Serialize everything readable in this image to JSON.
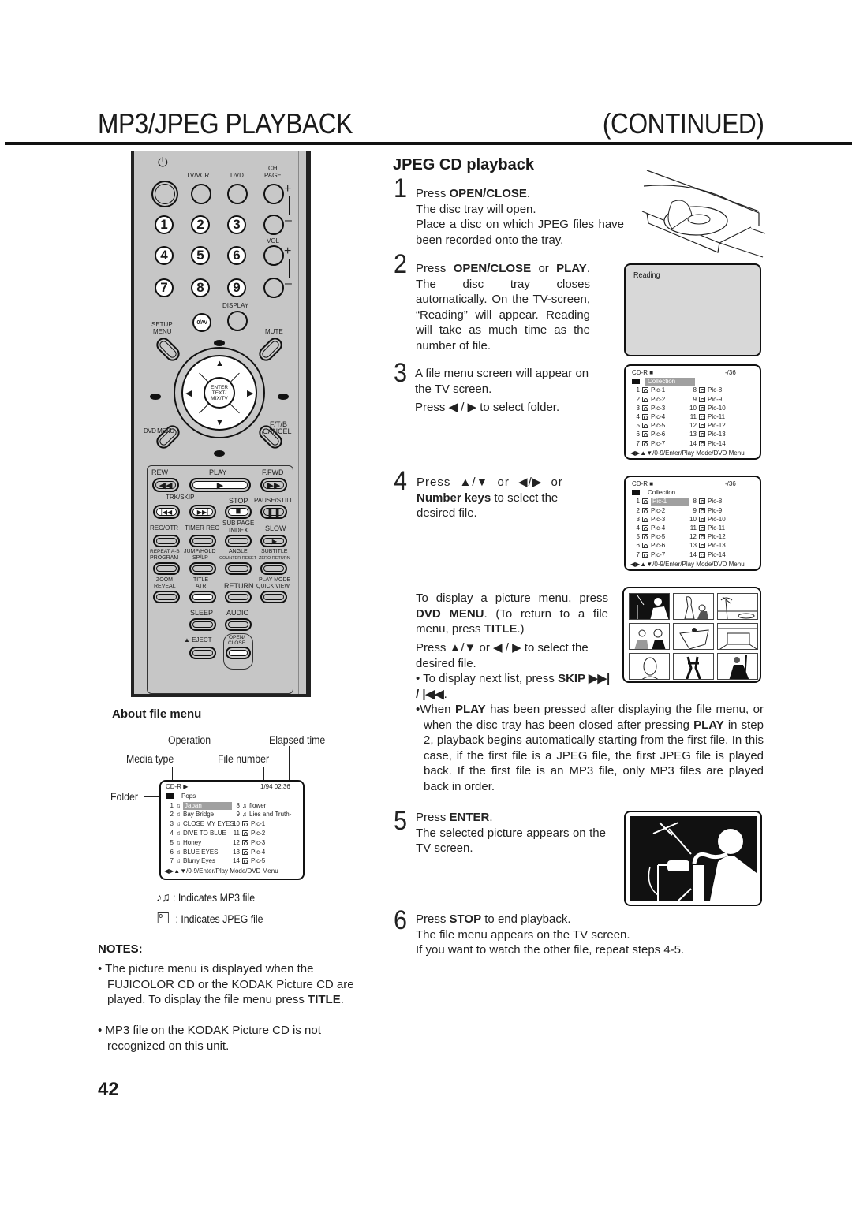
{
  "header": {
    "title": "MP3/JPEG PLAYBACK",
    "continued": "(CONTINUED)"
  },
  "remote": {
    "power_icon": "⏻",
    "top_labels": [
      "TV/VCR",
      "DVD",
      "CH",
      "PAGE"
    ],
    "numbers": [
      "1",
      "2",
      "3",
      "4",
      "5",
      "6",
      "7",
      "8",
      "9"
    ],
    "vol_label": "VOL",
    "display_label": "DISPLAY",
    "zero_av": "0/AV",
    "setup": "SETUP",
    "menu": "MENU",
    "mute": "MUTE",
    "enter_lines": [
      "ENTER",
      "TEXT/",
      "MIX/TV"
    ],
    "dvd_menu": "DVD MENU",
    "ftb": "F/T/B",
    "cancel": "CANCEL",
    "rew": "REW",
    "play": "PLAY",
    "ffwd": "F.FWD",
    "trk_skip": "TRK/SKIP",
    "stop": "STOP",
    "pause_still": "PAUSE/STILL",
    "rec_otr": "REC/OTR",
    "timer_rec": "TIMER REC",
    "sub_page": "SUB PAGE",
    "index": "INDEX",
    "slow": "SLOW",
    "repeat_ab": "REPEAT A-B",
    "program": "PROGRAM",
    "jump_hold": "JUMP/HOLD",
    "sp_lp": "SP/LP",
    "angle": "ANGLE",
    "counter_reset": "COUNTER RESET",
    "subtitle": "SUBTITLE",
    "zero_return": "ZERO RETURN",
    "zoom": "ZOOM",
    "reveal": "REVEAL",
    "title": "TITLE",
    "atr": "ATR",
    "return": "RETURN",
    "play_mode": "PLAY MODE",
    "quick_view": "QUICK VIEW",
    "sleep": "SLEEP",
    "audio": "AUDIO",
    "eject": "▲ EJECT",
    "open_close_1": "OPEN/",
    "open_close_2": "CLOSE"
  },
  "section_title": "JPEG CD playback",
  "steps": {
    "s1": {
      "num": "1",
      "l1_pre": "Press ",
      "l1_b": "OPEN/CLOSE",
      "l1_post": ".",
      "l2": "The disc tray will open.",
      "l3": "Place a disc on which JPEG files have been recorded onto the tray."
    },
    "s2": {
      "num": "2",
      "pre": "Press ",
      "b1": "OPEN/CLOSE",
      "mid": " or ",
      "b2": "PLAY",
      "post": ".",
      "body": "The disc tray closes automatically. On the TV-screen, “Reading” will appear. Reading will take as much time as the number of file."
    },
    "s3": {
      "num": "3",
      "l1": "A file menu screen will appear on the TV screen.",
      "l2": "Press ◀ / ▶ to select folder."
    },
    "s4": {
      "num": "4",
      "l1": "Press ▲/▼ or ◀/▶ or",
      "b": "Number keys",
      "l2": " to select the desired file."
    },
    "picture_menu": {
      "p1_pre": "To display a picture menu, press ",
      "p1_b1": "DVD MENU",
      "p1_mid": ". (To return to a file menu, press ",
      "p1_b2": "TITLE",
      "p1_post": ".)",
      "p2": "Press ▲/▼ or ◀ / ▶ to select the desired file.",
      "bullet1_pre": "To display next list, press ",
      "bullet1_b": "SKIP ▶▶| / |◀◀",
      "bullet1_post": ".",
      "bullet2_pre": "When ",
      "bullet2_b1": "PLAY",
      "bullet2_mid": " has been pressed after displaying the file menu, or when the disc tray has been closed after pressing ",
      "bullet2_b2": "PLAY",
      "bullet2_post": " in step 2, playback begins automatically starting from the first file. In this case, if the first file is a JPEG file, the first JPEG file is played back. If the first file is an MP3 file, only MP3 files are played back in order."
    },
    "s5": {
      "num": "5",
      "pre": "Press ",
      "b": "ENTER",
      "post": ".",
      "body": "The selected picture appears on the TV screen."
    },
    "s6": {
      "num": "6",
      "pre": "Press ",
      "b": "STOP",
      "post": " to end playback.",
      "l2": "The file menu appears on the TV screen.",
      "l3": "If you want to watch the other file, repeat steps 4-5."
    }
  },
  "tv_reading": {
    "text": "Reading"
  },
  "file_menu_jpeg": {
    "media": "CD-R",
    "status_icon": "■",
    "count": "-/36",
    "folder": "Collection",
    "left": [
      {
        "n": "1",
        "name": "Pic-1"
      },
      {
        "n": "2",
        "name": "Pic-2"
      },
      {
        "n": "3",
        "name": "Pic-3"
      },
      {
        "n": "4",
        "name": "Pic-4"
      },
      {
        "n": "5",
        "name": "Pic-5"
      },
      {
        "n": "6",
        "name": "Pic-6"
      },
      {
        "n": "7",
        "name": "Pic-7"
      }
    ],
    "right": [
      {
        "n": "8",
        "name": "Pic-8"
      },
      {
        "n": "9",
        "name": "Pic-9"
      },
      {
        "n": "10",
        "name": "Pic-10"
      },
      {
        "n": "11",
        "name": "Pic-11"
      },
      {
        "n": "12",
        "name": "Pic-12"
      },
      {
        "n": "13",
        "name": "Pic-13"
      },
      {
        "n": "14",
        "name": "Pic-14"
      }
    ],
    "footer": "◀▶▲▼/0-9/Enter/Play Mode/DVD Menu"
  },
  "about": {
    "title": "About file menu",
    "operation": "Operation",
    "elapsed": "Elapsed time",
    "media_type": "Media type",
    "file_number": "File number",
    "folder": "Folder",
    "menu": {
      "media": "CD-R",
      "op": "▶",
      "filenum": "1/94",
      "time": "02:36",
      "folder": "Pops",
      "left": [
        {
          "n": "1",
          "type": "mp3",
          "name": "Japan"
        },
        {
          "n": "2",
          "type": "mp3",
          "name": "Bay Bridge"
        },
        {
          "n": "3",
          "type": "mp3",
          "name": "CLOSE MY EYES"
        },
        {
          "n": "4",
          "type": "mp3",
          "name": "DIVE TO BLUE"
        },
        {
          "n": "5",
          "type": "mp3",
          "name": "Honey"
        },
        {
          "n": "6",
          "type": "mp3",
          "name": "BLUE EYES"
        },
        {
          "n": "7",
          "type": "mp3",
          "name": "Blurry Eyes"
        }
      ],
      "right": [
        {
          "n": "8",
          "type": "mp3",
          "name": "flower"
        },
        {
          "n": "9",
          "type": "mp3",
          "name": "Lies and Truth-"
        },
        {
          "n": "10",
          "type": "jpeg",
          "name": "Pic-1"
        },
        {
          "n": "11",
          "type": "jpeg",
          "name": "Pic-2"
        },
        {
          "n": "12",
          "type": "jpeg",
          "name": "Pic-3"
        },
        {
          "n": "13",
          "type": "jpeg",
          "name": "Pic-4"
        },
        {
          "n": "14",
          "type": "jpeg",
          "name": "Pic-5"
        }
      ],
      "footer": "◀▶▲▼/0-9/Enter/Play Mode/DVD Menu"
    },
    "legend_mp3": ": Indicates MP3 file",
    "legend_jpeg": ": Indicates JPEG file"
  },
  "notes": {
    "title": "NOTES:",
    "n1_pre": "The picture menu is displayed when the FUJICOLOR CD or the KODAK Picture CD are played. To display the file menu press ",
    "n1_b": "TITLE",
    "n1_post": ".",
    "n2": "MP3 file on the KODAK Picture CD is not recognized on this unit."
  },
  "page_number": "42"
}
